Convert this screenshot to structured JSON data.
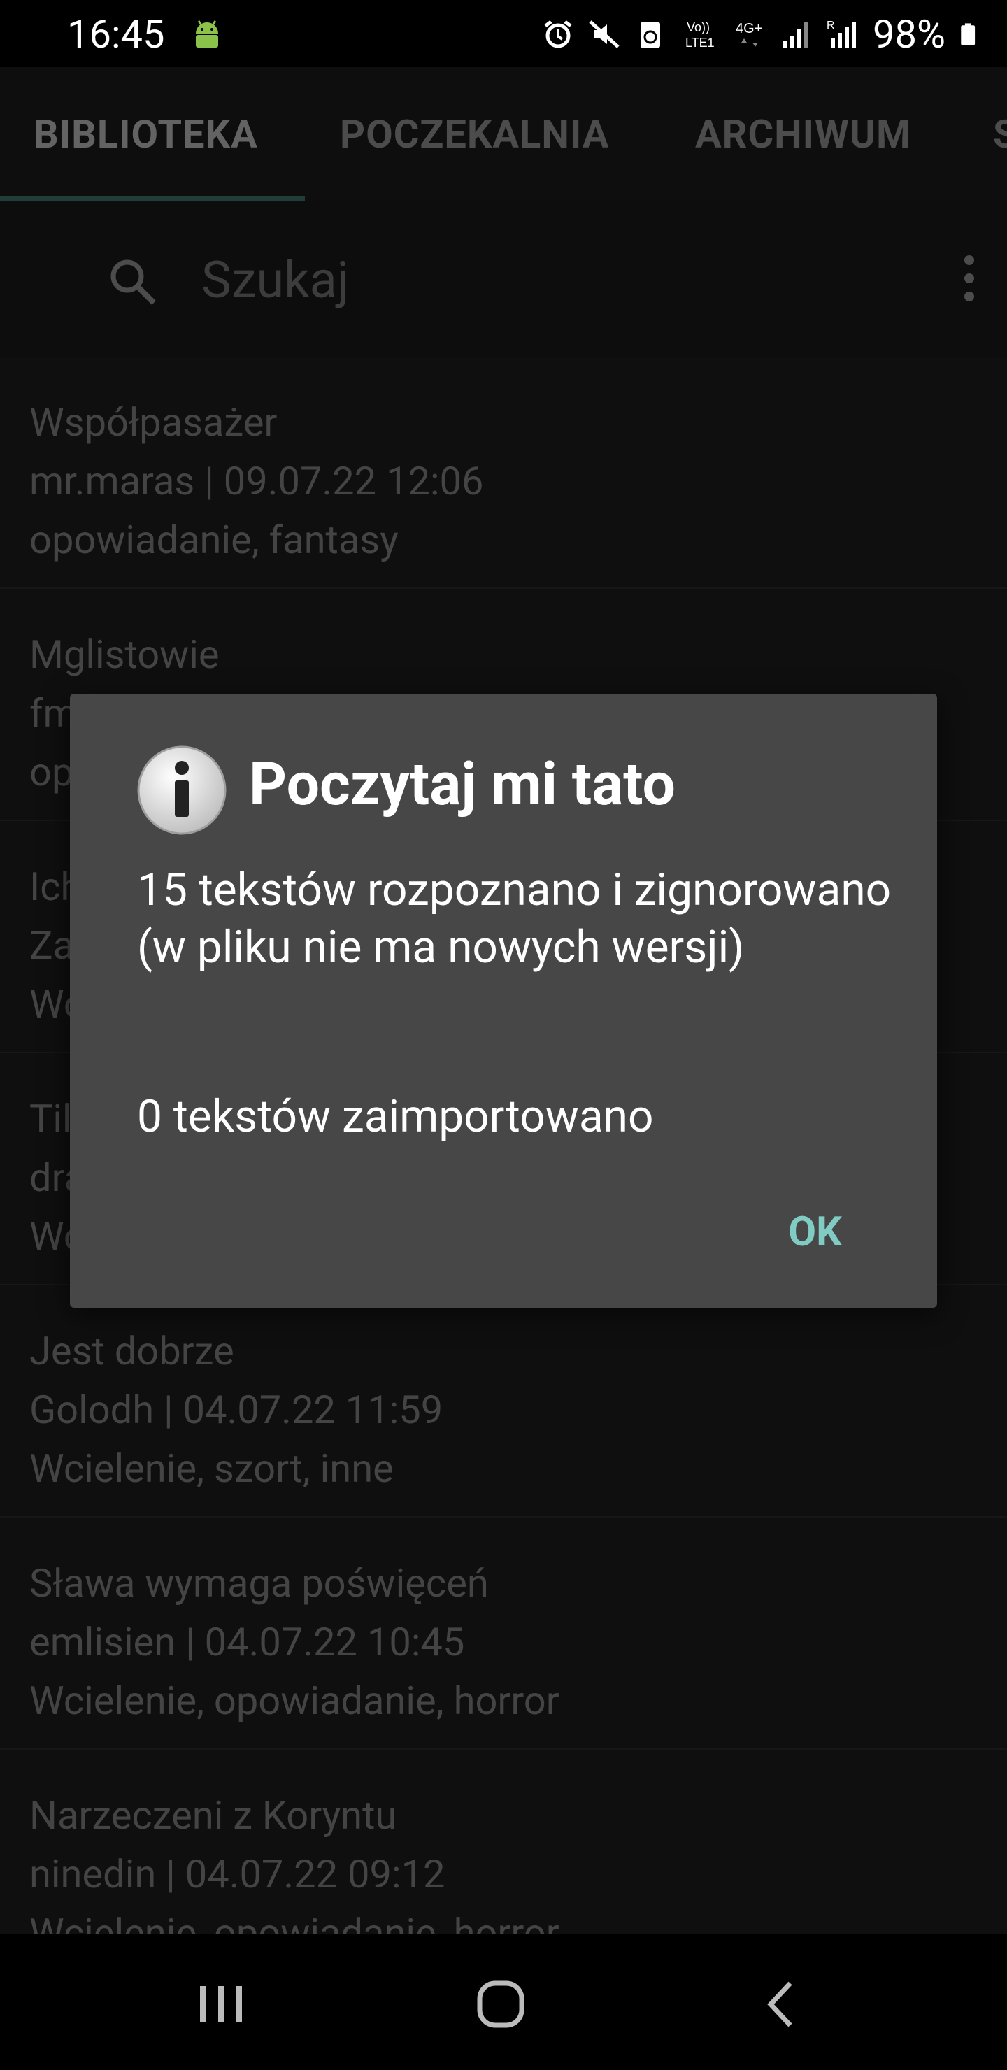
{
  "status_bar": {
    "time": "16:45",
    "battery": "98%",
    "icons": [
      "android-icon",
      "alarm-icon",
      "mute-icon",
      "recycle-icon",
      "volte-icon",
      "4g-icon",
      "signal-icon",
      "signal-roaming-icon",
      "battery-icon"
    ]
  },
  "tabs": [
    {
      "label": "BIBLIOTEKA",
      "active": true
    },
    {
      "label": "POCZEKALNIA",
      "active": false
    },
    {
      "label": "ARCHIWUM",
      "active": false
    },
    {
      "label": "S",
      "active": false
    }
  ],
  "search": {
    "placeholder": "Szukaj"
  },
  "list": [
    {
      "title": "Współpasażer",
      "meta": "mr.maras | 09.07.22 12:06",
      "tags": "opowiadanie, fantasy"
    },
    {
      "title": "Mglistowie",
      "meta": "fm.",
      "tags": "op"
    },
    {
      "title": "Ich",
      "meta": "Za",
      "tags": "Wo"
    },
    {
      "title": "Til",
      "meta": "dra",
      "tags": "Wo"
    },
    {
      "title": "Jest dobrze",
      "meta": "Golodh | 04.07.22 11:59",
      "tags": "Wcielenie, szort, inne"
    },
    {
      "title": "Sława wymaga poświęceń",
      "meta": "emlisien | 04.07.22 10:45",
      "tags": "Wcielenie, opowiadanie, horror"
    },
    {
      "title": "Narzeczeni z Koryntu",
      "meta": "ninedin | 04.07.22 09:12",
      "tags": "Wcielenie, opowiadanie, horror"
    }
  ],
  "dialog": {
    "title": "Poczytaj mi tato",
    "message": "15 tekstów rozpoznano i zignorowano (w pliku nie ma nowych wersji)",
    "message2": "0 tekstów zaimportowano",
    "ok_label": "OK"
  },
  "colors": {
    "accent": "#80cbc4",
    "dialog_bg": "#474747",
    "background": "#1a1a1a"
  }
}
